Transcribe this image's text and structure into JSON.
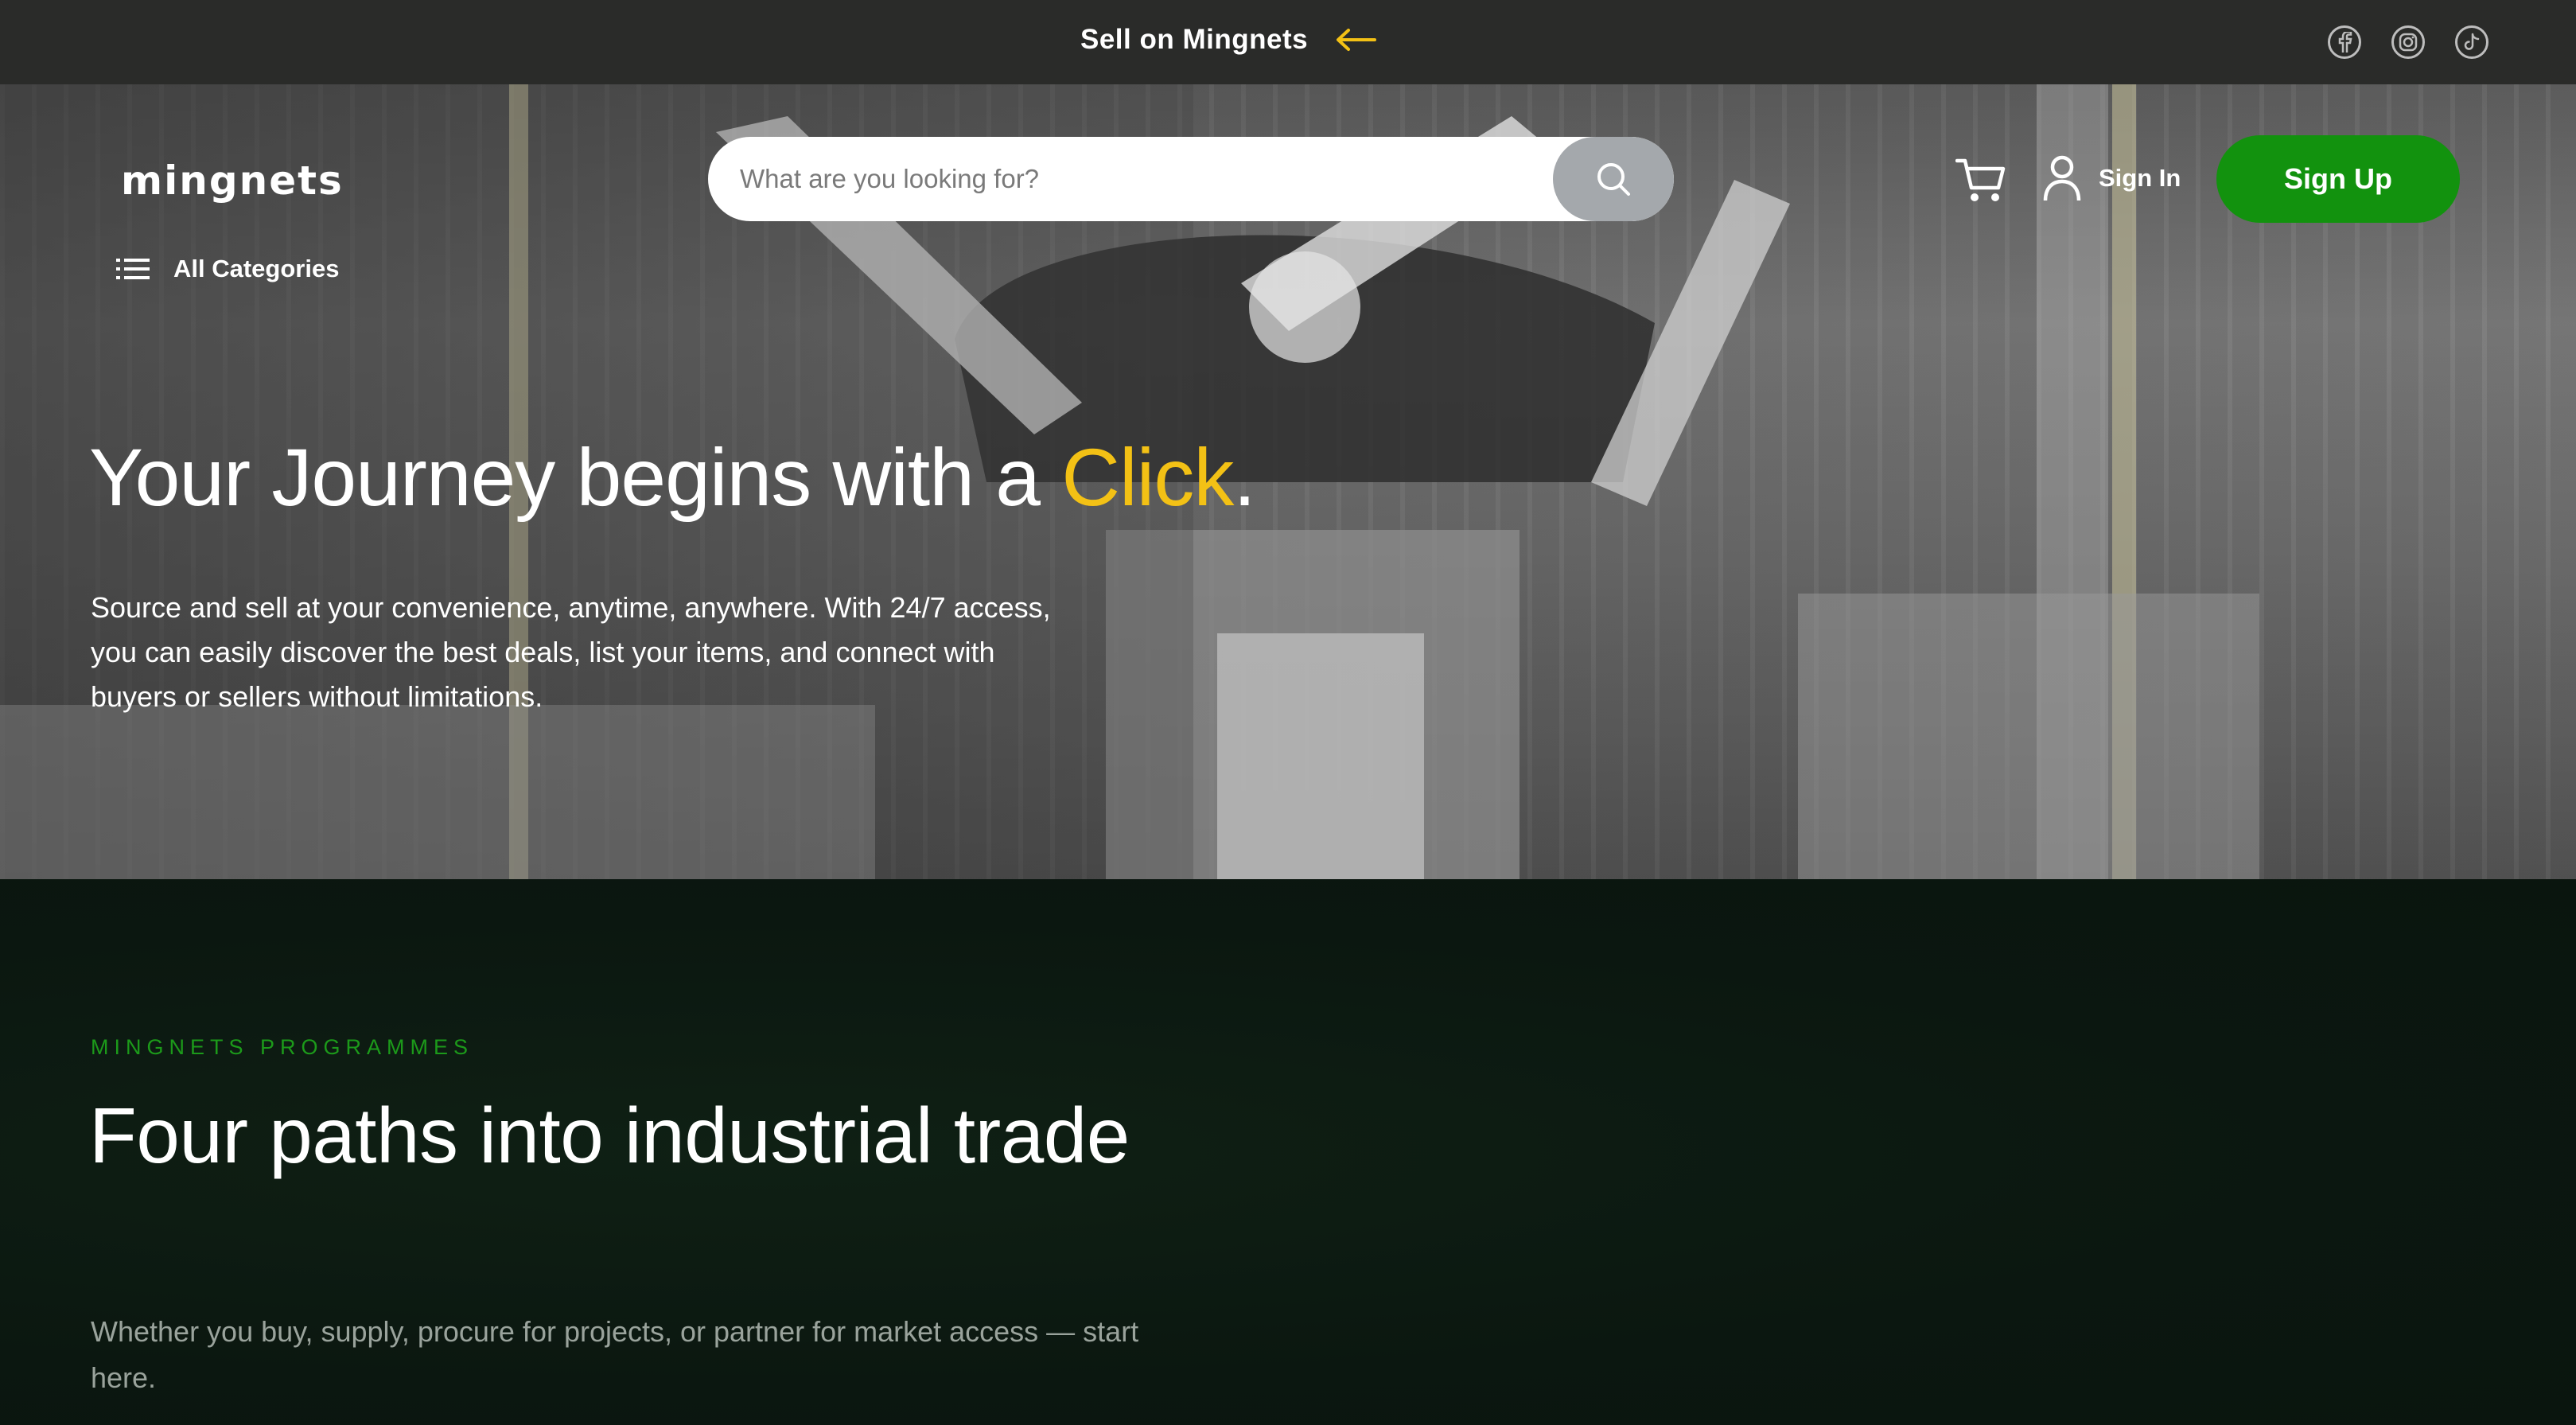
{
  "topbar": {
    "sell_label": "Sell on Mingnets",
    "sell_arrow_icon": "arrow-left-icon",
    "arrow_color": "#f3c115",
    "socials": [
      "facebook-icon",
      "instagram-icon",
      "tiktok-icon"
    ]
  },
  "header": {
    "logo": "mingnets",
    "search": {
      "placeholder": "What are you looking for?",
      "value": ""
    },
    "cart_icon": "cart-icon",
    "signin_label": "Sign In",
    "signup_label": "Sign Up",
    "signup_color": "#12920e",
    "categories_label": "All Categories"
  },
  "hero": {
    "title_start": "Your Journey begins with a ",
    "title_accent": "Click",
    "title_end": ".",
    "accent_color": "#f3c115",
    "description": "Source and sell at your convenience, anytime, anywhere. With 24/7 access, you can easily discover the best deals, list your items, and connect with buyers or sellers without limitations."
  },
  "programmes": {
    "eyebrow": "MINGNETS PROGRAMMES",
    "title": "Four paths into industrial trade",
    "description": "Whether you buy, supply, procure for projects, or partner for market access — start here."
  }
}
